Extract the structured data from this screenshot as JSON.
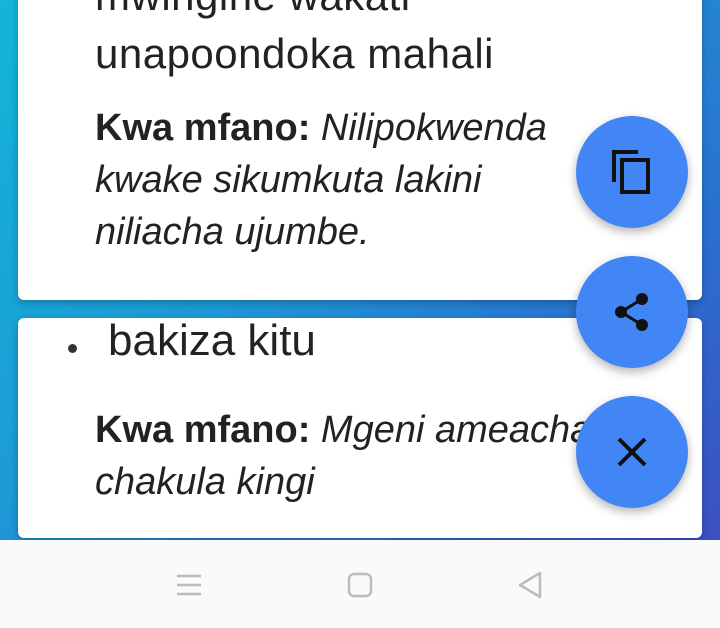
{
  "card1": {
    "definition_lines": [
      "mwingine wakati",
      "unapoondoka mahali"
    ],
    "example_label": "Kwa mfano:",
    "example_sentence": " Nilipokwenda kwake sikumkuta lakini niliacha ujumbe."
  },
  "card2": {
    "word": "bakiza kitu",
    "example_label": "Kwa mfano:",
    "example_sentence": " Mgeni ameacha chakula kingi"
  },
  "fabs": {
    "copy_icon": "copy-icon",
    "share_icon": "share-icon",
    "close_icon": "close-icon",
    "color": "#4285f4"
  },
  "navbar": {
    "menu_icon": "menu-icon",
    "home_icon": "home-icon",
    "back_icon": "back-icon"
  }
}
